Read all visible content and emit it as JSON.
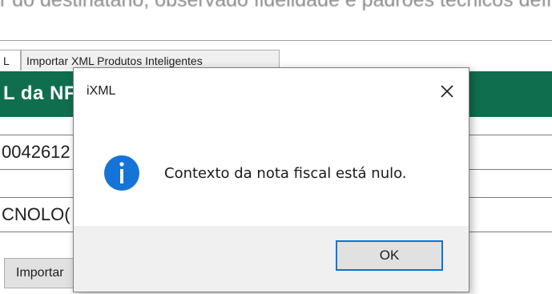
{
  "background": {
    "top_text": "r do destinatário, observado fidelidade e padrões técnicos definid",
    "tabs": [
      {
        "label": "L"
      },
      {
        "label": "Importar XML Produtos Inteligentes"
      }
    ],
    "section_header": "L da NF",
    "fields": [
      {
        "value": "0042612"
      },
      {
        "value": "CNOLO("
      }
    ],
    "import_button_label": "Importar"
  },
  "dialog": {
    "title": "iXML",
    "message": "Contexto da nota fiscal está nulo.",
    "icon": "info-icon",
    "ok_label": "OK",
    "close_icon": "close-icon"
  },
  "colors": {
    "green_header": "#0f6e4e",
    "info_icon": "#1574d6",
    "button_focus_border": "#0078d7",
    "dialog_footer": "#f0f0f0"
  }
}
